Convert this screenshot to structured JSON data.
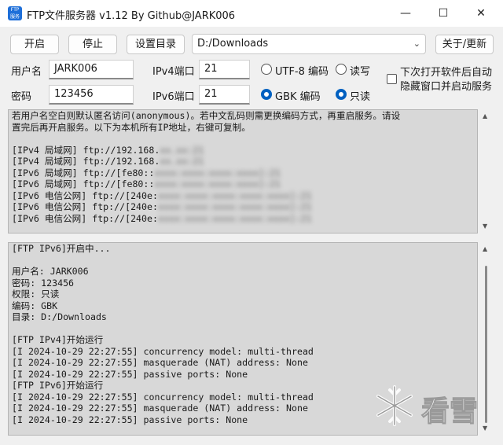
{
  "title": "FTP文件服务器 v1.12 By Github@JARK006",
  "app_icon_text": [
    "FTP",
    "服务"
  ],
  "window": {
    "minimize": "—",
    "maximize": "☐",
    "close": "✕"
  },
  "toolbar": {
    "start": "开启",
    "stop": "停止",
    "set_dir": "设置目录",
    "dir_value": "D:/Downloads",
    "about": "关于/更新"
  },
  "form": {
    "user_label": "用户名",
    "user_value": "JARK006",
    "pass_label": "密码",
    "pass_value": "123456",
    "ipv4_label": "IPv4端口",
    "ipv4_value": "21",
    "ipv6_label": "IPv6端口",
    "ipv6_value": "21",
    "utf8_label": "UTF-8 编码",
    "gbk_label": "GBK 编码",
    "rw_label": "读写",
    "ro_label": "只读",
    "encoding_selected": "GBK 编码",
    "permission_selected": "只读",
    "autostart_line1": "下次打开软件后自动",
    "autostart_line2": "隐藏窗口并启动服务",
    "autostart_checked": false
  },
  "info_panel": {
    "line1": "若用户名空白则默认匿名访问(anonymous)。若中文乱码则需更换编码方式，再重启服务。请设",
    "line2": "置完后再开启服务。以下为本机所有IP地址，右键可复制。",
    "addresses": [
      {
        "prefix": "[IPv4 局域网] ftp://192.168.",
        "hidden": "xx.xx:21"
      },
      {
        "prefix": "[IPv4 局域网] ftp://192.168.",
        "hidden": "xx.xx:21"
      },
      {
        "prefix": "[IPv6 局域网] ftp://[fe80::",
        "hidden": "xxxx:xxxx:xxxx:xxxx]:21"
      },
      {
        "prefix": "[IPv6 局域网] ftp://[fe80::",
        "hidden": "xxxx:xxxx:xxxx:xxxx]:21"
      },
      {
        "prefix": "[IPv6 电信公网] ftp://[240e:",
        "hidden": "xxxx:xxxx:xxxx:xxxx:xxxx]:21"
      },
      {
        "prefix": "[IPv6 电信公网] ftp://[240e:",
        "hidden": "xxxx:xxxx:xxxx:xxxx:xxxx]:21"
      },
      {
        "prefix": "[IPv6 电信公网] ftp://[240e:",
        "hidden": "xxxx:xxxx:xxxx:xxxx:xxxx]:21"
      }
    ]
  },
  "log_panel": {
    "lines": [
      "[FTP IPv6]开启中...",
      "",
      "用户名: JARK006",
      "密码: 123456",
      "权限: 只读",
      "编码: GBK",
      "目录: D:/Downloads",
      "",
      "[FTP IPv4]开始运行",
      "[I 2024-10-29 22:27:55] concurrency model: multi-thread",
      "[I 2024-10-29 22:27:55] masquerade (NAT) address: None",
      "[I 2024-10-29 22:27:55] passive ports: None",
      "[FTP IPv6]开始运行",
      "[I 2024-10-29 22:27:55] concurrency model: multi-thread",
      "[I 2024-10-29 22:27:55] masquerade (NAT) address: None",
      "[I 2024-10-29 22:27:55] passive ports: None"
    ]
  },
  "watermark_text": "看雪",
  "colors": {
    "accent": "#0060c0",
    "panel_bg": "#d8d8d8",
    "window_bg": "#f0f0f0"
  }
}
